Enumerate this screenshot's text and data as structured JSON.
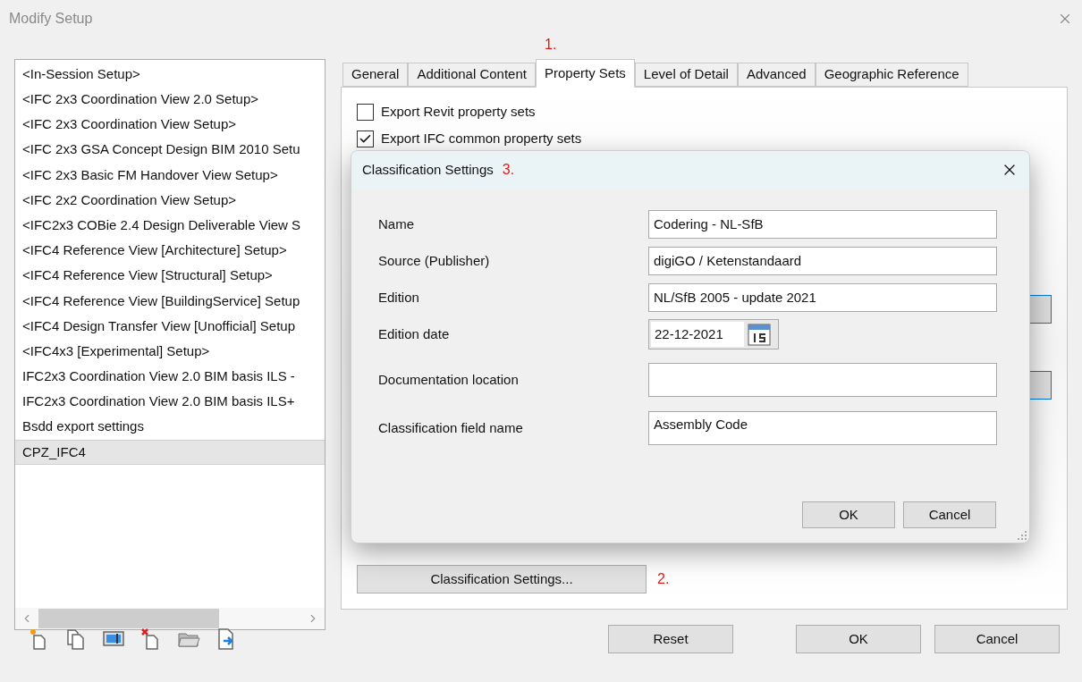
{
  "window": {
    "title": "Modify Setup"
  },
  "setups": [
    {
      "label": "<In-Session Setup>",
      "selected": false
    },
    {
      "label": "<IFC 2x3 Coordination View 2.0 Setup>",
      "selected": false
    },
    {
      "label": "<IFC 2x3 Coordination View Setup>",
      "selected": false
    },
    {
      "label": "<IFC 2x3 GSA Concept Design BIM 2010 Setu",
      "selected": false
    },
    {
      "label": "<IFC 2x3 Basic FM Handover View Setup>",
      "selected": false
    },
    {
      "label": "<IFC 2x2 Coordination View Setup>",
      "selected": false
    },
    {
      "label": "<IFC2x3 COBie 2.4 Design Deliverable View S",
      "selected": false
    },
    {
      "label": "<IFC4 Reference View [Architecture] Setup>",
      "selected": false
    },
    {
      "label": "<IFC4 Reference View [Structural] Setup>",
      "selected": false
    },
    {
      "label": "<IFC4 Reference View [BuildingService] Setup",
      "selected": false
    },
    {
      "label": "<IFC4 Design Transfer View [Unofficial] Setup",
      "selected": false
    },
    {
      "label": "<IFC4x3 [Experimental] Setup>",
      "selected": false
    },
    {
      "label": "IFC2x3 Coordination View 2.0 BIM basis ILS -",
      "selected": false
    },
    {
      "label": "IFC2x3 Coordination View 2.0 BIM basis ILS+",
      "selected": false
    },
    {
      "label": "Bsdd export settings",
      "selected": false
    },
    {
      "label": "CPZ_IFC4",
      "selected": true
    }
  ],
  "tabs": [
    {
      "label": "General",
      "selected": false
    },
    {
      "label": "Additional Content",
      "selected": false
    },
    {
      "label": "Property Sets",
      "selected": true,
      "annotation": "1."
    },
    {
      "label": "Level of Detail",
      "selected": false
    },
    {
      "label": "Advanced",
      "selected": false
    },
    {
      "label": "Geographic Reference",
      "selected": false
    }
  ],
  "options": [
    {
      "label": "Export Revit property sets",
      "checked": false
    },
    {
      "label": "Export IFC common property sets",
      "checked": true
    }
  ],
  "classification_button": {
    "label": "Classification Settings...",
    "annotation": "2."
  },
  "footer_buttons": [
    "Reset",
    "OK",
    "Cancel"
  ],
  "dialog": {
    "title": "Classification Settings",
    "annotation": "3.",
    "fields": [
      {
        "label": "Name",
        "value": "Codering - NL-SfB",
        "kind": "line"
      },
      {
        "label": "Source (Publisher)",
        "value": "digiGO / Ketenstandaard",
        "kind": "line"
      },
      {
        "label": "Edition",
        "value": "NL/SfB 2005 - update 2021",
        "kind": "line"
      },
      {
        "label": "Edition date",
        "value": "22-12-2021",
        "kind": "date"
      },
      {
        "label": "Documentation location",
        "kind": "area"
      },
      {
        "label": "Classification field name",
        "value": "Assembly Code",
        "kind": "area"
      }
    ],
    "buttons": [
      "OK",
      "Cancel"
    ]
  }
}
